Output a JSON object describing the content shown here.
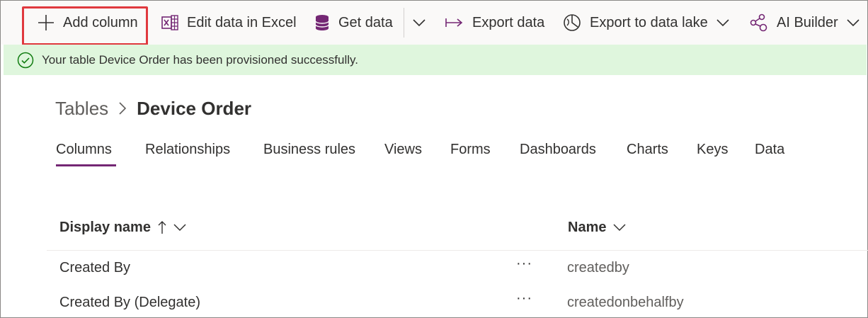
{
  "command_bar": {
    "add_column": "Add column",
    "edit_excel": "Edit data in Excel",
    "get_data": "Get data",
    "export_data": "Export data",
    "export_lake": "Export to data lake",
    "ai_builder": "AI Builder"
  },
  "message": {
    "text": "Your table Device Order has been provisioned successfully.",
    "status_color": "#107c10"
  },
  "breadcrumb": {
    "root": "Tables",
    "current": "Device Order"
  },
  "tabs": [
    {
      "label": "Columns",
      "active": true
    },
    {
      "label": "Relationships"
    },
    {
      "label": "Business rules"
    },
    {
      "label": "Views"
    },
    {
      "label": "Forms"
    },
    {
      "label": "Dashboards"
    },
    {
      "label": "Charts"
    },
    {
      "label": "Keys"
    },
    {
      "label": "Data"
    }
  ],
  "table": {
    "columns": {
      "display_name": "Display name",
      "name": "Name"
    },
    "rows": [
      {
        "display_name": "Created By",
        "more": "···",
        "name": "createdby"
      },
      {
        "display_name": "Created By (Delegate)",
        "more": "···",
        "name": "createdonbehalfby"
      }
    ]
  },
  "colors": {
    "accent": "#742774",
    "success_bg": "#dff6dd",
    "highlight": "#e0393e"
  }
}
